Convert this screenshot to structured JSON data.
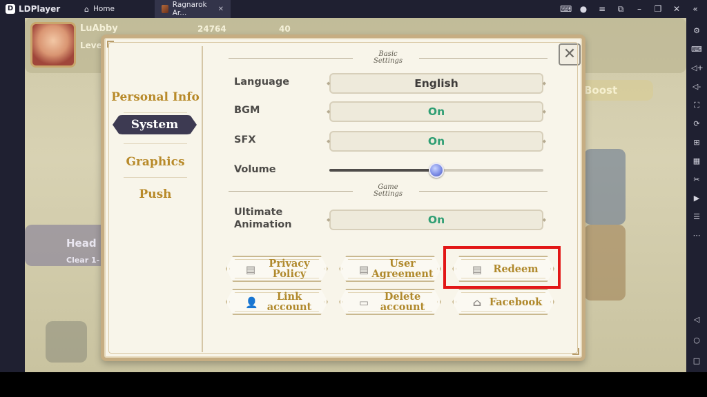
{
  "emulator": {
    "app_name": "LDPlayer",
    "tabs": [
      {
        "label": "Home",
        "icon": "home-icon"
      },
      {
        "label": "Ragnarok Ar...",
        "icon": "game-icon"
      }
    ],
    "window_controls": [
      "gamepad-icon",
      "account-icon",
      "menu-icon",
      "popout-icon",
      "minimize-icon",
      "restore-icon",
      "close-icon",
      "collapse-icon"
    ],
    "sidebar_icons": [
      "settings-icon",
      "keyboard-icon",
      "volume-up-icon",
      "volume-down-icon",
      "fullscreen-icon",
      "rotate-icon",
      "add-icon",
      "apk-icon",
      "scissors-icon",
      "video-icon",
      "file-icon",
      "more-icon"
    ],
    "nav_icons": [
      "back-icon",
      "home-circle-icon",
      "recent-apps-icon"
    ]
  },
  "game_bg": {
    "player_name": "LuAbby",
    "level_label": "Leve",
    "currency1": "24764",
    "currency2": "40",
    "boost_label": "Boost",
    "head_label": "Head",
    "clear_label": "Clear 1-"
  },
  "dialog": {
    "nav": {
      "personal_info": "Personal Info",
      "system": "System",
      "graphics": "Graphics",
      "push": "Push"
    },
    "section_basic": {
      "line1": "Basic",
      "line2": "Settings"
    },
    "section_game": {
      "line1": "Game",
      "line2": "Settings"
    },
    "rows": {
      "language_label": "Language",
      "language_value": "English",
      "bgm_label": "BGM",
      "bgm_value": "On",
      "sfx_label": "SFX",
      "sfx_value": "On",
      "volume_label": "Volume",
      "volume_level": 0.5,
      "ultimate_line1": "Ultimate",
      "ultimate_line2": "Animation",
      "ultimate_value": "On"
    },
    "buttons": {
      "privacy_line1": "Privacy",
      "privacy_line2": "Policy",
      "user_line1": "User",
      "user_line2": "Agreement",
      "redeem": "Redeem",
      "link_line1": "Link",
      "link_line2": "account",
      "delete_line1": "Delete",
      "delete_line2": "account",
      "facebook": "Facebook"
    },
    "close_symbol": "✕"
  },
  "colors": {
    "accent_gold": "#b88a2a",
    "on_green": "#2e9e73",
    "nav_active_bg": "#3d3a52",
    "highlight_red": "#e21616"
  }
}
